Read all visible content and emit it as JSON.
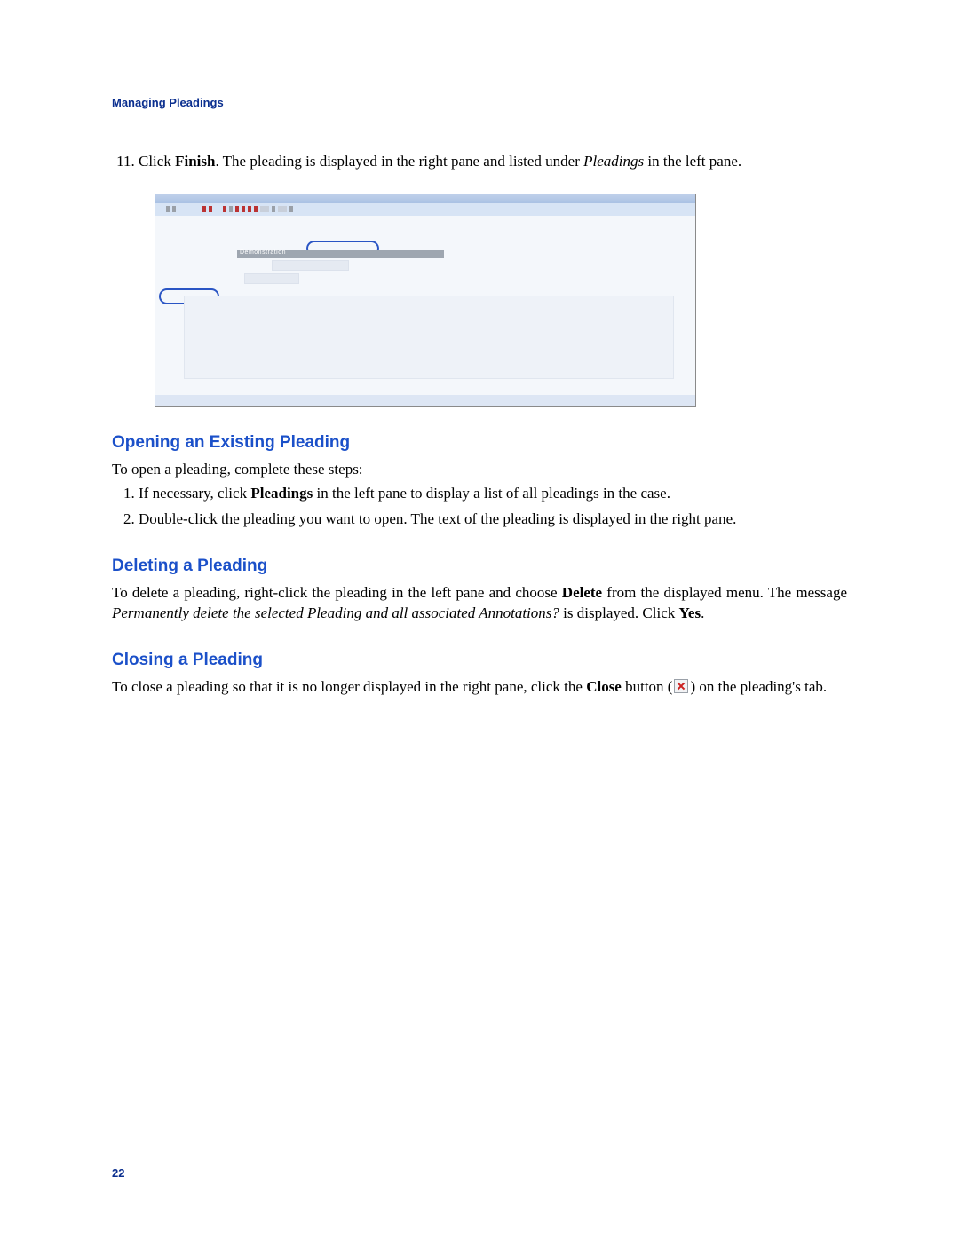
{
  "chapter_header": "Managing Pleadings",
  "page_number": "22",
  "step11": {
    "prefix": "Click ",
    "bold1": "Finish",
    "mid1": ". The pleading is displayed in the right pane and listed under ",
    "italic1": "Pleadings",
    "suffix": " in the left pane."
  },
  "figure": {
    "gray_bar_label": "Demonstration"
  },
  "opening": {
    "heading": "Opening an Existing Pleading",
    "intro": "To open a pleading, complete these steps:",
    "step1_prefix": "If necessary, click ",
    "step1_bold": "Pleadings",
    "step1_suffix": " in the left pane to display a list of all pleadings in the case.",
    "step2": "Double-click the pleading you want to open. The text of the pleading is displayed in the right pane."
  },
  "deleting": {
    "heading": "Deleting a Pleading",
    "p_prefix": "To delete a pleading, right-click the pleading in the left pane and choose ",
    "p_bold1": "Delete",
    "p_mid1": " from the displayed menu. The message ",
    "p_italic": "Permanently delete the selected Pleading and all associated Annotations?",
    "p_mid2": " is displayed. Click ",
    "p_bold2": "Yes",
    "p_suffix": "."
  },
  "closing": {
    "heading": "Closing a Pleading",
    "p_prefix": "To close a pleading so that it is no longer displayed in the right pane, click the ",
    "p_bold1": "Close",
    "p_mid1": " button (",
    "p_mid2": ") on the pleading's tab."
  }
}
